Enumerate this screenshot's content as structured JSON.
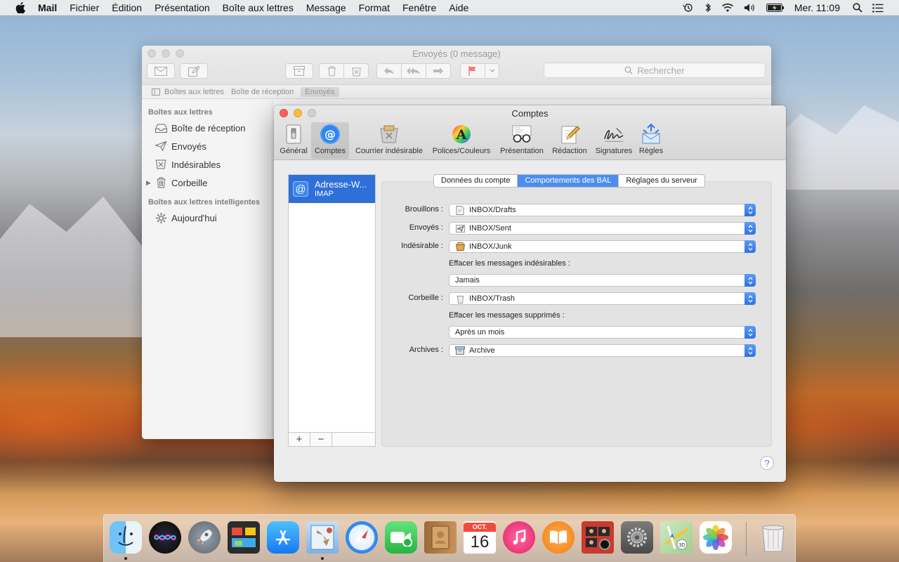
{
  "menubar": {
    "app": "Mail",
    "items": [
      "Fichier",
      "Édition",
      "Présentation",
      "Boîte aux lettres",
      "Message",
      "Format",
      "Fenêtre",
      "Aide"
    ],
    "clock": "Mer. 11:09"
  },
  "mail_window": {
    "title": "Envoyés (0 message)",
    "search_placeholder": "Rechercher",
    "favorites": [
      "Boîtes aux lettres",
      "Boîte de réception",
      "Envoyés"
    ],
    "sidebar": {
      "section1": "Boîtes aux lettres",
      "items": [
        "Boîte de réception",
        "Envoyés",
        "Indésirables",
        "Corbeille"
      ],
      "section2": "Boîtes aux lettres intelligentes",
      "smart_items": [
        "Aujourd'hui"
      ]
    }
  },
  "prefs_window": {
    "title": "Comptes",
    "toolbar": [
      "Général",
      "Comptes",
      "Courrier indésirable",
      "Polices/Couleurs",
      "Présentation",
      "Rédaction",
      "Signatures",
      "Règles"
    ],
    "account": {
      "name": "Adresse-W...",
      "type": "IMAP"
    },
    "tabs": [
      "Données du compte",
      "Comportements des BAL",
      "Réglages du serveur"
    ],
    "active_tab": "Comportements des BAL",
    "fields": {
      "drafts": {
        "label": "Brouillons :",
        "value": "INBOX/Drafts"
      },
      "sent": {
        "label": "Envoyés :",
        "value": "INBOX/Sent"
      },
      "junk": {
        "label": "Indésirable :",
        "value": "INBOX/Junk"
      },
      "junk_erase_note": "Effacer les messages indésirables :",
      "junk_erase": "Jamais",
      "trash": {
        "label": "Corbeille :",
        "value": "INBOX/Trash"
      },
      "trash_erase_note": "Effacer les messages supprimés :",
      "trash_erase": "Après un mois",
      "archive": {
        "label": "Archives :",
        "value": "Archive"
      }
    },
    "add_label": "+",
    "remove_label": "−",
    "help_label": "?"
  },
  "dock": {
    "calendar_month": "OCT.",
    "calendar_day": "16"
  },
  "colors": {
    "accent": "#2f6fd8",
    "close": "#fc605c",
    "minimize": "#fdbc40",
    "zoom": "#cfcfcf"
  }
}
